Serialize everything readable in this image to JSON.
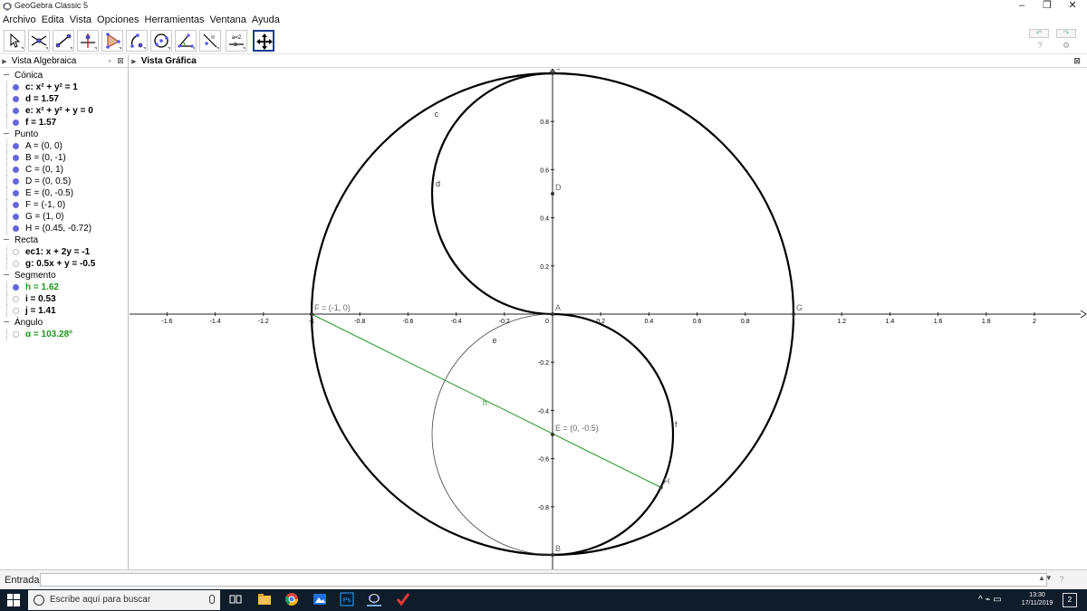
{
  "window": {
    "title": "GeoGebra Classic 5",
    "controls": {
      "minimize": "–",
      "maximize": "❐",
      "close": "✕"
    }
  },
  "menubar": {
    "items": [
      "Archivo",
      "Edita",
      "Vista",
      "Opciones",
      "Herramientas",
      "Ventana",
      "Ayuda"
    ]
  },
  "toolbar": {
    "tools": [
      "move-tool",
      "point-tool",
      "segment-tool",
      "perpendicular-tool",
      "polygon-tool",
      "circle-arc-tool",
      "circle-tool",
      "angle-tool",
      "reflect-tool",
      "slider-tool",
      "move-view-tool"
    ],
    "slider_tool_label": "a=2",
    "active_tool": "move-view-tool",
    "undo_label": "↶",
    "redo_label": "↷",
    "help_icon": "?",
    "settings_icon": "⚙"
  },
  "algebra_view": {
    "title": "Vista Algebraica",
    "categories": [
      {
        "name": "Cónica",
        "items": [
          {
            "text": "c: x² + y² = 1",
            "visible": true,
            "style": "b"
          },
          {
            "text": "d = 1.57",
            "visible": true,
            "style": "b"
          },
          {
            "text": "e: x² + y² + y = 0",
            "visible": true,
            "style": "b"
          },
          {
            "text": "f = 1.57",
            "visible": true,
            "style": "b"
          }
        ]
      },
      {
        "name": "Punto",
        "items": [
          {
            "text": "A = (0, 0)",
            "visible": true,
            "style": ""
          },
          {
            "text": "B = (0, -1)",
            "visible": true,
            "style": ""
          },
          {
            "text": "C = (0, 1)",
            "visible": true,
            "style": ""
          },
          {
            "text": "D = (0, 0.5)",
            "visible": true,
            "style": ""
          },
          {
            "text": "E = (0, -0.5)",
            "visible": true,
            "style": ""
          },
          {
            "text": "F = (-1, 0)",
            "visible": true,
            "style": ""
          },
          {
            "text": "G = (1, 0)",
            "visible": true,
            "style": ""
          },
          {
            "text": "H = (0.45, -0.72)",
            "visible": true,
            "style": ""
          }
        ]
      },
      {
        "name": "Recta",
        "items": [
          {
            "text": "ec1: x + 2y = -1",
            "visible": false,
            "style": "b"
          },
          {
            "text": "g: 0.5x + y = -0.5",
            "visible": false,
            "style": "b"
          }
        ]
      },
      {
        "name": "Segmento",
        "items": [
          {
            "text": "h = 1.62",
            "visible": true,
            "style": "green"
          },
          {
            "text": "i = 0.53",
            "visible": false,
            "style": "b"
          },
          {
            "text": "j = 1.41",
            "visible": false,
            "style": "b"
          }
        ]
      },
      {
        "name": "Ángulo",
        "items": [
          {
            "text": "α = 103.28°",
            "visible": false,
            "style": "green"
          }
        ]
      }
    ]
  },
  "graphics_view": {
    "title": "Vista Gráfica",
    "x_ticks": [
      "-1.6",
      "-1.4",
      "-1.2",
      "-1",
      "-0.8",
      "-0.6",
      "-0.4",
      "-0.2",
      "0",
      "0.2",
      "0.4",
      "0.6",
      "0.8",
      "1",
      "1.2",
      "1.4",
      "1.6",
      "1.8",
      "2"
    ],
    "y_ticks": [
      "0.8",
      "0.6",
      "0.4",
      "0.2",
      "-0.2",
      "-0.4",
      "-0.6",
      "-0.8"
    ],
    "points": [
      {
        "name": "A",
        "label": "A",
        "x": 0,
        "y": 0
      },
      {
        "name": "B",
        "label": "B",
        "x": 0,
        "y": -1
      },
      {
        "name": "C",
        "label": "C",
        "x": 0,
        "y": 1
      },
      {
        "name": "D",
        "label": "D",
        "x": 0,
        "y": 0.5
      },
      {
        "name": "E",
        "label": "E = (0, -0.5)",
        "x": 0,
        "y": -0.5
      },
      {
        "name": "F",
        "label": "F = (-1, 0)",
        "x": -1,
        "y": 0
      },
      {
        "name": "G",
        "label": "G",
        "x": 1,
        "y": 0
      },
      {
        "name": "H",
        "label": "H",
        "x": 0.45,
        "y": -0.72
      }
    ],
    "object_labels": {
      "c": "c",
      "d": "d",
      "e": "e",
      "f": "f",
      "h": "h"
    },
    "colors": {
      "curve": "#000000",
      "segment": "#2f9e2f",
      "axis": "#222222",
      "label": "#666666"
    }
  },
  "input_bar": {
    "label": "Entrada:",
    "value": "",
    "help_icon": "?"
  },
  "taskbar": {
    "search_placeholder": "Escribe aquí para buscar",
    "time": "13:30",
    "date": "17/11/2019",
    "notifications": "2",
    "tray_icons": "^ ⌁ ▭"
  }
}
